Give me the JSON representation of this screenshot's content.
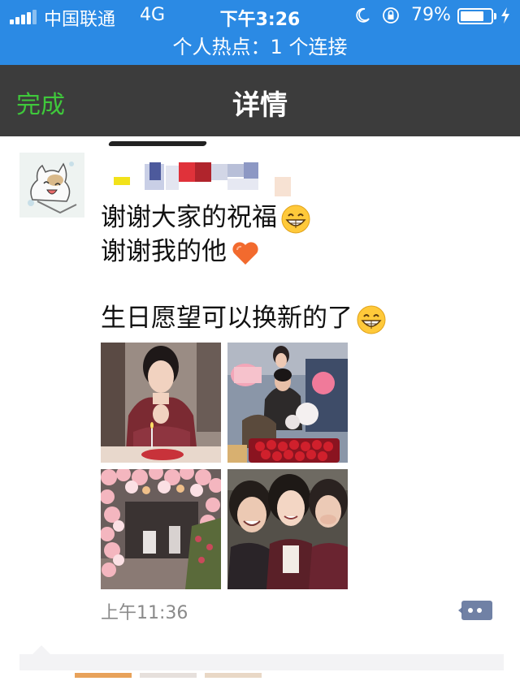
{
  "status_bar": {
    "carrier": "中国联通",
    "network": "4G",
    "time": "下午3:26",
    "battery_percent": "79%",
    "battery_level": 0.79,
    "hotspot_text": "个人热点：1 个连接",
    "icons": [
      "signal-icon",
      "moon-icon",
      "rotation-lock-icon",
      "battery-icon",
      "charging-bolt-icon"
    ]
  },
  "nav": {
    "back_label": "完成",
    "title": "详情"
  },
  "post": {
    "lines": [
      "谢谢大家的祝福",
      "谢谢我的他",
      "生日愿望可以换新的了"
    ],
    "emojis": [
      "grin-emoji-icon",
      "orange-heart-icon",
      "grin-emoji-icon"
    ],
    "timestamp": "上午11:36",
    "photos": [
      "birthday-candle-photo",
      "couple-with-flowers-photo",
      "balloon-party-photo",
      "three-friends-selfie-photo"
    ]
  },
  "colors": {
    "status_bar_bg": "#2b8ae4",
    "nav_bg": "#3c3c3c",
    "done_green": "#3fc83b",
    "timestamp_gray": "#8a8a8a"
  }
}
